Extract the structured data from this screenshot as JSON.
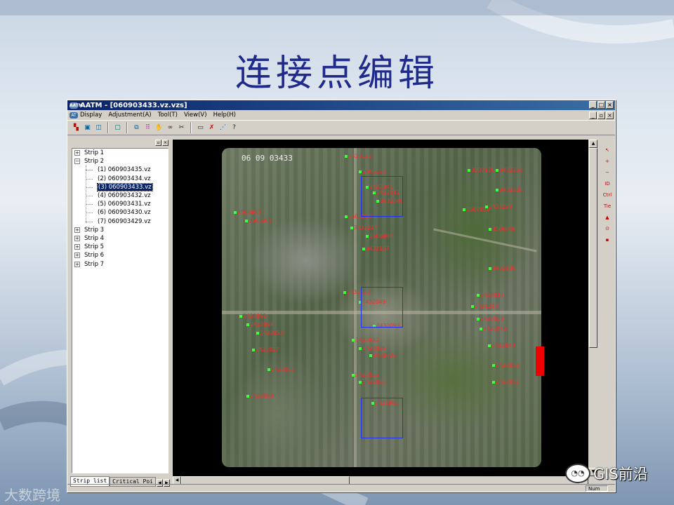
{
  "slide": {
    "title": "连接点编辑"
  },
  "window": {
    "title": "AATM - [060903433.vz.vzs]",
    "title_icon": "AATM"
  },
  "menu": [
    "Display",
    "Adjustment(A)",
    "Tool(T)",
    "View(V)",
    "Help(H)"
  ],
  "toolbar_icons": [
    "strip-view-icon",
    "grid-view-icon",
    "pair-view-icon",
    "single-image-icon",
    "zoom-fit-icon",
    "points-grid-icon",
    "hand-pan-icon",
    "binoculars-icon",
    "scissors-icon",
    "keyboard-icon",
    "cut-tool-icon",
    "coordinates-icon",
    "help-icon"
  ],
  "tree": {
    "strips": [
      {
        "label": "Strip 1",
        "expanded": false
      },
      {
        "label": "Strip 2",
        "expanded": true,
        "children": [
          {
            "label": "(1) 060903435.vz",
            "selected": false
          },
          {
            "label": "(2) 060903434.vz",
            "selected": false
          },
          {
            "label": "(3) 060903433.vz",
            "selected": true
          },
          {
            "label": "(4) 060903432.vz",
            "selected": false
          },
          {
            "label": "(5) 060903431.vz",
            "selected": false
          },
          {
            "label": "(6) 060903430.vz",
            "selected": false
          },
          {
            "label": "(7) 060903429.vz",
            "selected": false
          }
        ]
      },
      {
        "label": "Strip 3",
        "expanded": false
      },
      {
        "label": "Strip 4",
        "expanded": false
      },
      {
        "label": "Strip 5",
        "expanded": false
      },
      {
        "label": "Strip 6",
        "expanded": false
      },
      {
        "label": "Strip 7",
        "expanded": false
      }
    ]
  },
  "tabs": [
    "Strip list",
    "Critical Poi"
  ],
  "photo": {
    "id_text": "06 09 03433",
    "tie_points": [
      "3430122",
      "3506122",
      "3432341",
      "3432311",
      "3432346",
      "3507126",
      "3432251",
      "3432235",
      "3507058",
      "3432228",
      "3506983",
      "3506301",
      "3506988",
      "3432224",
      "3506904",
      "3432157",
      "3506048",
      "3432138",
      "3432132",
      "3432049",
      "3432015",
      "3431213",
      "3432053",
      "3432076",
      "3432093",
      "3432092",
      "3432094",
      "3432053",
      "3432032",
      "3432026",
      "3432023",
      "3432027",
      "3432051",
      "3432043",
      "3432056",
      "3432036",
      "3432061",
      "3432099",
      "3432071",
      "3431991"
    ]
  },
  "right_tools": [
    {
      "name": "pointer-tool-icon",
      "glyph": "↖"
    },
    {
      "name": "zoom-in-icon",
      "glyph": "+"
    },
    {
      "name": "zoom-out-icon",
      "glyph": "−"
    },
    {
      "name": "id-tool",
      "glyph": "ID"
    },
    {
      "name": "control-point-tool",
      "glyph": "Ctrl"
    },
    {
      "name": "tie-point-tool",
      "glyph": "Tie"
    },
    {
      "name": "triangle-tool-icon",
      "glyph": "▲"
    },
    {
      "name": "target-tool-icon",
      "glyph": "⊙"
    },
    {
      "name": "save-icon",
      "glyph": "▪"
    }
  ],
  "status": {
    "num": "Num"
  },
  "watermarks": {
    "left": "大数跨境",
    "right": "GIS前沿"
  }
}
